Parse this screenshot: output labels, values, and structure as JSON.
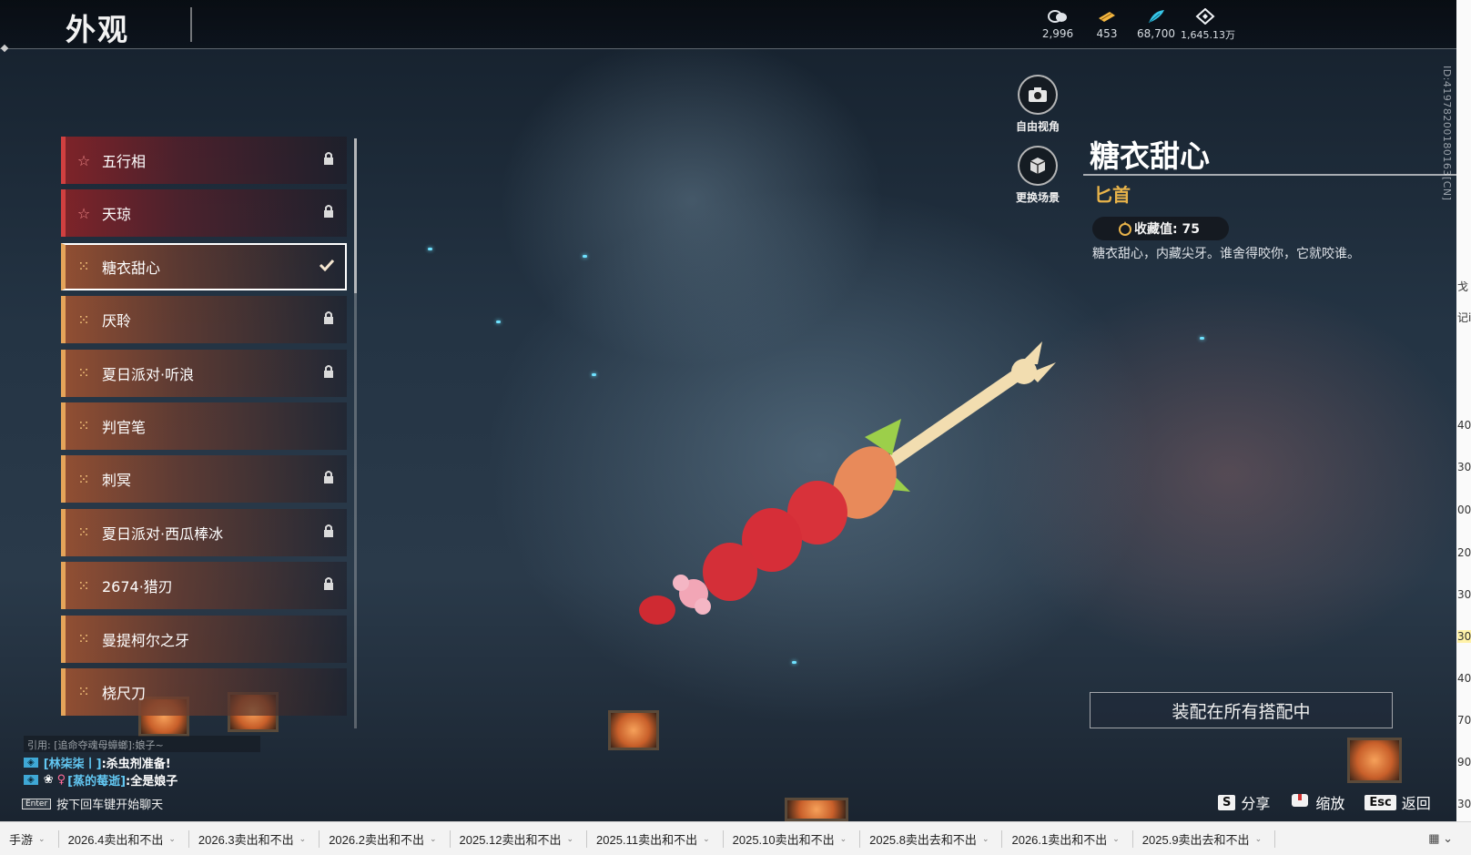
{
  "window": {
    "title": "外观"
  },
  "currencies": [
    {
      "icon": "coin-icon",
      "value": "2,996"
    },
    {
      "icon": "ticket-icon",
      "value": "453"
    },
    {
      "icon": "feather-icon",
      "value": "68,700"
    },
    {
      "icon": "diamond-icon",
      "value": "1,645.13万"
    }
  ],
  "id_label": "ID:41978200180163[CN]",
  "list": {
    "items": [
      {
        "name": "五行相",
        "rarity": "red",
        "state": "locked"
      },
      {
        "name": "天琼",
        "rarity": "red",
        "state": "locked"
      },
      {
        "name": "糖衣甜心",
        "rarity": "gold",
        "state": "equipped"
      },
      {
        "name": "厌聆",
        "rarity": "gold",
        "state": "locked"
      },
      {
        "name": "夏日派对·听浪",
        "rarity": "gold",
        "state": "locked"
      },
      {
        "name": "判官笔",
        "rarity": "gold",
        "state": ""
      },
      {
        "name": "刺冥",
        "rarity": "gold",
        "state": "locked"
      },
      {
        "name": "夏日派对·西瓜棒冰",
        "rarity": "gold",
        "state": "locked"
      },
      {
        "name": "2674·猎刃",
        "rarity": "gold",
        "state": "locked"
      },
      {
        "name": "曼提柯尔之牙",
        "rarity": "gold",
        "state": ""
      },
      {
        "name": "桡尺刀",
        "rarity": "gold",
        "state": ""
      }
    ]
  },
  "camera": {
    "free_view": "自由视角",
    "change_scene": "更换场景"
  },
  "detail": {
    "name": "糖衣甜心",
    "type": "匕首",
    "collect_label": "收藏值: 75",
    "description": "糖衣甜心，内藏尖牙。谁舍得咬你，它就咬谁。",
    "equip_all": "装配在所有搭配中"
  },
  "hints": [
    {
      "key": "S",
      "label": "分享"
    },
    {
      "key": "",
      "label": "缩放"
    },
    {
      "key": "Esc",
      "label": "返回"
    }
  ],
  "chat": {
    "quote": "引用: [追命夺魂母蟑螂]:娘子~",
    "lines": [
      {
        "user": "[林柒柒丨]",
        "text": ":杀虫剂准备!"
      },
      {
        "user": "[蒸的莓逝]",
        "text": ":全是娘子"
      }
    ],
    "enter_key": "Enter",
    "enter_hint": "按下回车键开始聊天"
  },
  "side_strip": [
    "戈",
    "记i",
    "40",
    "30'",
    "00'",
    "20'",
    "30'",
    "30'",
    "40'",
    "70'",
    "90'",
    "30'"
  ],
  "sheet_tabs": [
    "手游",
    "2026.4卖出和不出",
    "2026.3卖出和不出",
    "2026.2卖出和不出",
    "2025.12卖出和不出",
    "2025.11卖出和不出",
    "2025.10卖出和不出",
    "2025.8卖出去和不出",
    "2026.1卖出和不出",
    "2025.9卖出去和不出"
  ]
}
